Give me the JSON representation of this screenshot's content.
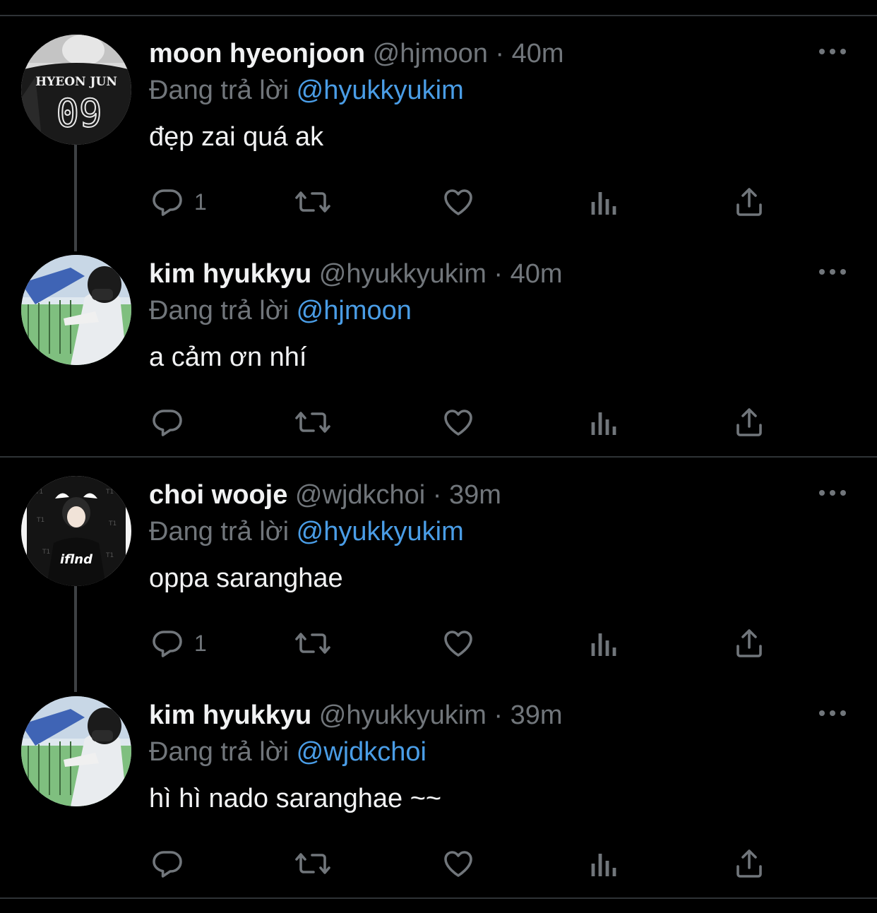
{
  "colors": {
    "background": "#000000",
    "divider": "#2f3336",
    "secondary_text": "#71767b",
    "mention": "#4a9de6"
  },
  "tweets": [
    {
      "name": "moon hyeonjoon",
      "handle": "@hjmoon",
      "separator": "·",
      "time": "40m",
      "replying_label": "Đang trả lời",
      "replying_to": "@hyukkyukim",
      "text": "đẹp zai quá ak",
      "reply_count": "1",
      "avatar": {
        "jersey_name": "HYEON JUN",
        "jersey_number": "09"
      }
    },
    {
      "name": "kim hyukkyu",
      "handle": "@hyukkyukim",
      "separator": "·",
      "time": "40m",
      "replying_label": "Đang trả lời",
      "replying_to": "@hjmoon",
      "text": "a cảm ơn nhí",
      "reply_count": ""
    },
    {
      "name": "choi wooje",
      "handle": "@wjdkchoi",
      "separator": "·",
      "time": "39m",
      "replying_label": "Đang trả lời",
      "replying_to": "@hyukkyukim",
      "text": "oppa saranghae",
      "reply_count": "1",
      "avatar": {
        "shirt_text": "iflnd"
      }
    },
    {
      "name": "kim hyukkyu",
      "handle": "@hyukkyukim",
      "separator": "·",
      "time": "39m",
      "replying_label": "Đang trả lời",
      "replying_to": "@wjdkchoi",
      "text": "hì hì nado saranghae ~~",
      "reply_count": ""
    }
  ],
  "icons": {
    "reply": "reply-icon",
    "retweet": "retweet-icon",
    "like": "like-icon",
    "views": "views-icon",
    "share": "share-icon",
    "more": "more-icon"
  }
}
